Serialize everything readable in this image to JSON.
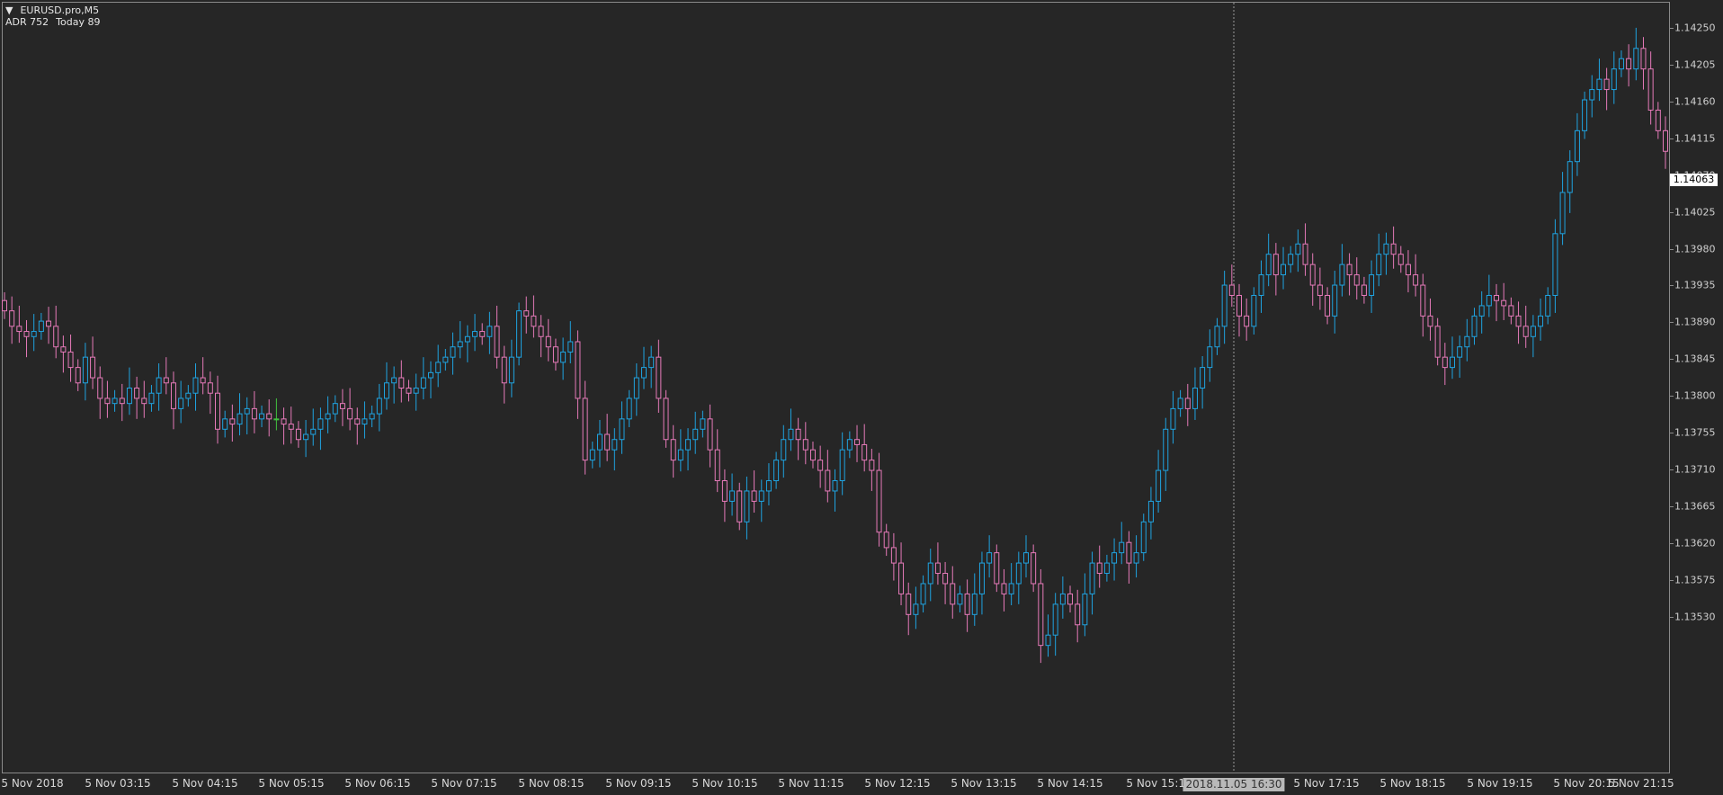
{
  "header": {
    "symbol": "EURUSD.pro,M5",
    "adr_label": "ADR 752",
    "today_label": "Today 89"
  },
  "price_axis": {
    "labels": [
      "1.14250",
      "1.14205",
      "1.14160",
      "1.14115",
      "1.14070",
      "1.14025",
      "1.13980",
      "1.13935",
      "1.13890",
      "1.13845",
      "1.13800",
      "1.13755",
      "1.13710",
      "1.13665",
      "1.13620",
      "1.13575",
      "1.13530"
    ],
    "current_price": "1.14063"
  },
  "time_axis": {
    "labels": [
      "5 Nov 2018",
      "5 Nov 03:15",
      "5 Nov 04:15",
      "5 Nov 05:15",
      "5 Nov 06:15",
      "5 Nov 07:15",
      "5 Nov 08:15",
      "5 Nov 09:15",
      "5 Nov 10:15",
      "5 Nov 11:15",
      "5 Nov 12:15",
      "5 Nov 13:15",
      "5 Nov 14:15",
      "5 Nov 15:15",
      "5 Nov 17:15",
      "5 Nov 18:15",
      "5 Nov 19:15",
      "5 Nov 20:15",
      "5 Nov 21:15"
    ],
    "crosshair_label": "2018.11.05 16:30"
  },
  "colors": {
    "background": "#262626",
    "bull": "#1fa3e0",
    "bear": "#e67ab9",
    "doji": "#41c23f",
    "crosshair": "#9a9a9a"
  },
  "chart_data": {
    "type": "candlestick",
    "ylim": [
      1.1352,
      1.1426
    ],
    "closes": [
      1.13965,
      1.1395,
      1.13945,
      1.1394,
      1.13945,
      1.13955,
      1.1395,
      1.1393,
      1.13925,
      1.1391,
      1.13895,
      1.1392,
      1.139,
      1.1388,
      1.13875,
      1.1388,
      1.13875,
      1.1389,
      1.1388,
      1.13875,
      1.13885,
      1.139,
      1.13895,
      1.1387,
      1.1388,
      1.13885,
      1.139,
      1.13895,
      1.13885,
      1.1385,
      1.1386,
      1.13855,
      1.13865,
      1.1387,
      1.1386,
      1.13865,
      1.1386,
      1.1386,
      1.13855,
      1.1385,
      1.1384,
      1.13845,
      1.1385,
      1.1386,
      1.13865,
      1.13875,
      1.1387,
      1.1386,
      1.13855,
      1.1386,
      1.13865,
      1.1388,
      1.13895,
      1.139,
      1.1389,
      1.13885,
      1.1389,
      1.139,
      1.13905,
      1.13915,
      1.1392,
      1.1393,
      1.13935,
      1.1394,
      1.13945,
      1.1394,
      1.1395,
      1.1392,
      1.13895,
      1.1392,
      1.13965,
      1.1396,
      1.1395,
      1.1394,
      1.1393,
      1.13915,
      1.13925,
      1.13935,
      1.1388,
      1.1382,
      1.1383,
      1.13845,
      1.1383,
      1.1384,
      1.1386,
      1.1388,
      1.139,
      1.1391,
      1.1392,
      1.1388,
      1.1384,
      1.1382,
      1.1383,
      1.1384,
      1.1385,
      1.1386,
      1.1383,
      1.138,
      1.1378,
      1.1379,
      1.1376,
      1.1379,
      1.1378,
      1.1379,
      1.138,
      1.1382,
      1.1384,
      1.1385,
      1.1384,
      1.1383,
      1.1382,
      1.1381,
      1.1379,
      1.138,
      1.1383,
      1.1384,
      1.13835,
      1.1382,
      1.1381,
      1.1375,
      1.13735,
      1.1372,
      1.1369,
      1.1367,
      1.1368,
      1.137,
      1.1372,
      1.1371,
      1.137,
      1.1368,
      1.1369,
      1.1367,
      1.1369,
      1.1372,
      1.1373,
      1.137,
      1.1369,
      1.137,
      1.1372,
      1.1373,
      1.137,
      1.1364,
      1.1365,
      1.1368,
      1.1369,
      1.1368,
      1.1366,
      1.1369,
      1.1372,
      1.1371,
      1.1372,
      1.1373,
      1.1374,
      1.1372,
      1.1373,
      1.1376,
      1.1378,
      1.1381,
      1.1385,
      1.1387,
      1.1388,
      1.1387,
      1.1389,
      1.1391,
      1.1393,
      1.1395,
      1.1399,
      1.1398,
      1.1396,
      1.1395,
      1.1398,
      1.14,
      1.1402,
      1.14,
      1.1401,
      1.1402,
      1.1403,
      1.1401,
      1.1399,
      1.1398,
      1.1396,
      1.1399,
      1.1401,
      1.14,
      1.1399,
      1.1398,
      1.14,
      1.1402,
      1.1403,
      1.1402,
      1.1401,
      1.14,
      1.1399,
      1.1396,
      1.1395,
      1.1392,
      1.1391,
      1.1392,
      1.1393,
      1.1394,
      1.1396,
      1.1397,
      1.1398,
      1.13975,
      1.1397,
      1.1396,
      1.1395,
      1.1394,
      1.1395,
      1.1396,
      1.1398,
      1.1404,
      1.1408,
      1.1411,
      1.1414,
      1.1417,
      1.1418,
      1.1419,
      1.1418,
      1.142,
      1.1421,
      1.142,
      1.1422,
      1.142,
      1.1416,
      1.1414,
      1.1412
    ]
  }
}
